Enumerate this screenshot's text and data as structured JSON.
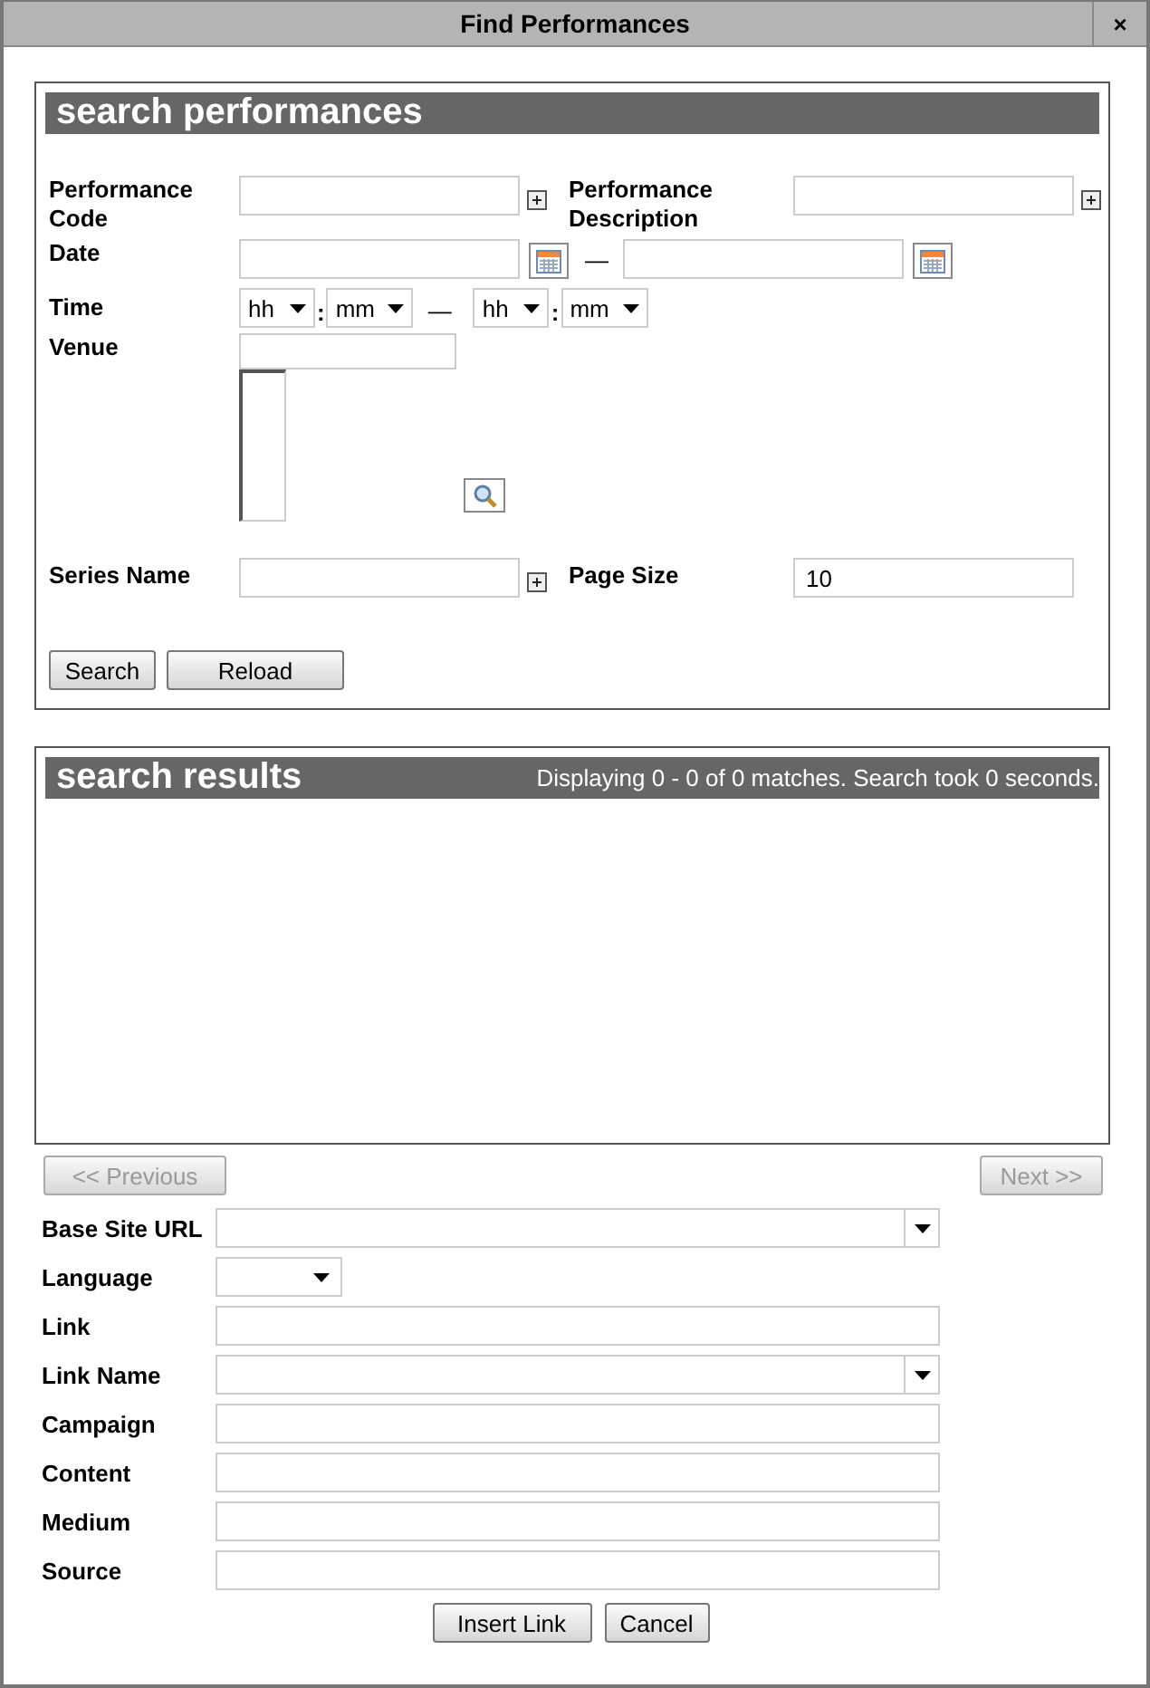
{
  "window": {
    "title": "Find Performances",
    "close": "×"
  },
  "search": {
    "title": "search performances",
    "performance_code": {
      "label": "Performance Code"
    },
    "performance_description": {
      "label": "Performance Description"
    },
    "date": {
      "label": "Date",
      "separator": "—"
    },
    "time": {
      "label": "Time",
      "from_hour": "hh",
      "from_colon": ":",
      "from_minute": "mm",
      "separator": "—",
      "to_hour": "hh",
      "to_colon": ":",
      "to_minute": "mm"
    },
    "venue": {
      "label": "Venue"
    },
    "series_name": {
      "label": "Series Name"
    },
    "page_size": {
      "label": "Page Size",
      "value": "10"
    },
    "buttons": [
      "Search",
      "Reload"
    ]
  },
  "results": {
    "title": "search results",
    "summary": "Displaying 0 - 0 of 0 matches. Search took 0 seconds."
  },
  "pager": {
    "previous": {
      "label": "<< Previous",
      "disabled": true
    },
    "next": {
      "label": "Next >>",
      "disabled": true
    }
  },
  "link_form": {
    "rows": [
      {
        "label": "Base Site URL",
        "kind": "combo"
      },
      {
        "label": "Language",
        "kind": "select"
      },
      {
        "label": "Link",
        "kind": "text"
      },
      {
        "label": "Link Name",
        "kind": "combo"
      },
      {
        "label": "Campaign",
        "kind": "text"
      },
      {
        "label": "Content",
        "kind": "text"
      },
      {
        "label": "Medium",
        "kind": "text"
      },
      {
        "label": "Source",
        "kind": "text"
      }
    ],
    "buttons": [
      "Insert Link",
      "Cancel"
    ]
  }
}
